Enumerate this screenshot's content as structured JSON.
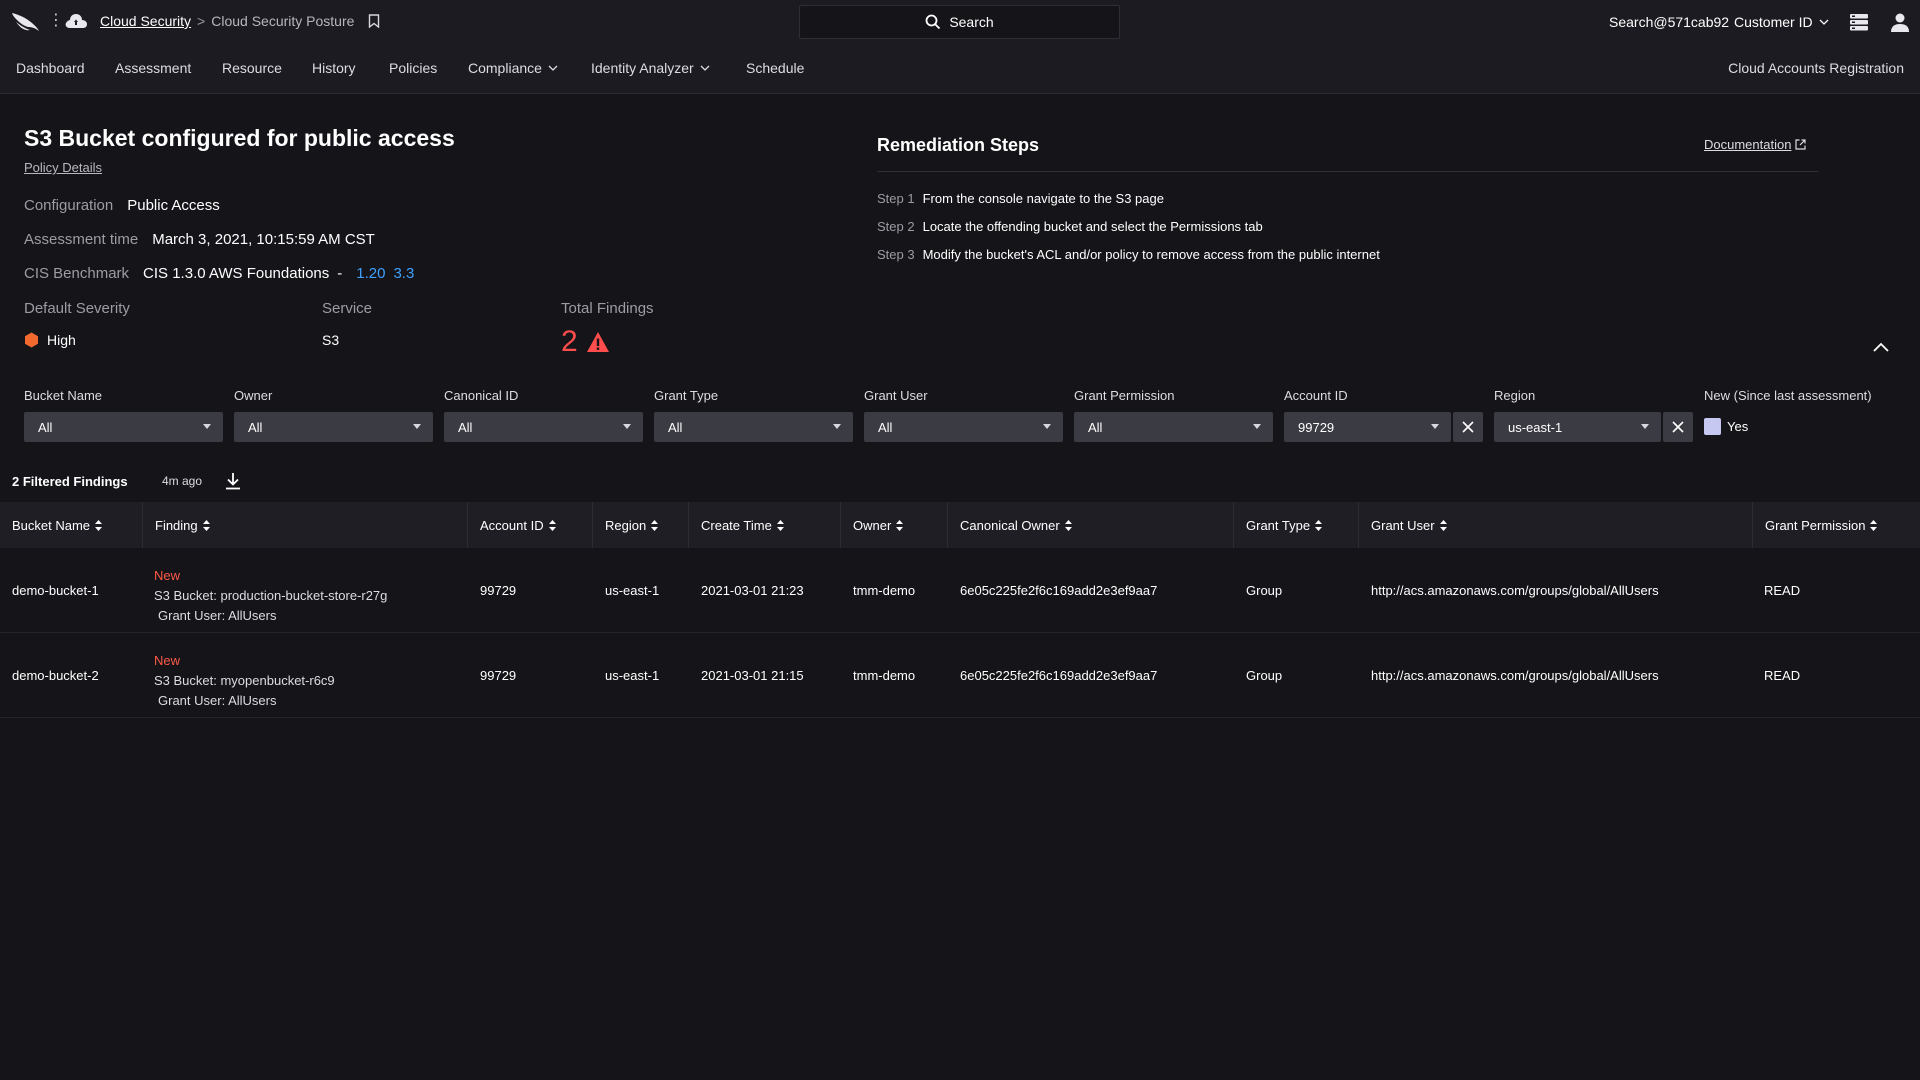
{
  "topbar": {
    "breadcrumb_root": "Cloud Security",
    "breadcrumb_sep": ">",
    "breadcrumb_current": "Cloud Security Posture",
    "search_label": "Search",
    "user": "Search@571cab92",
    "customer_label": "Customer ID"
  },
  "nav": {
    "items": [
      "Dashboard",
      "Assessment",
      "Resource",
      "History",
      "Policies",
      "Compliance",
      "Identity Analyzer",
      "Schedule"
    ],
    "right": "Cloud Accounts Registration"
  },
  "summary": {
    "title": "S3 Bucket configured for public access",
    "policy_link": "Policy Details",
    "configuration_label": "Configuration",
    "configuration_value": "Public Access",
    "assessment_label": "Assessment time",
    "assessment_value": "March 3, 2021, 10:15:59 AM CST",
    "cis_label": "CIS Benchmark",
    "cis_value": "CIS 1.3.0 AWS Foundations",
    "cis_dash": "-",
    "cis_refs": [
      "1.20",
      "3.3"
    ],
    "severity_label": "Default Severity",
    "severity_value": "High",
    "severity_color": "#f26a2e",
    "service_label": "Service",
    "service_value": "S3",
    "total_label": "Total Findings",
    "total_value": "2",
    "total_color": "#ff4d4d"
  },
  "remediation": {
    "title": "Remediation Steps",
    "doc_link": "Documentation",
    "steps": [
      {
        "num": "Step 1",
        "text": "From the console navigate to the S3 page"
      },
      {
        "num": "Step 2",
        "text": "Locate the offending bucket and select the Permissions tab"
      },
      {
        "num": "Step 3",
        "text": "Modify the bucket's ACL and/or policy to remove access from the public internet"
      }
    ]
  },
  "filters": [
    {
      "label": "Bucket Name",
      "value": "All"
    },
    {
      "label": "Owner",
      "value": "All"
    },
    {
      "label": "Canonical ID",
      "value": "All"
    },
    {
      "label": "Grant Type",
      "value": "All"
    },
    {
      "label": "Grant User",
      "value": "All"
    },
    {
      "label": "Grant Permission",
      "value": "All"
    },
    {
      "label": "Account ID",
      "value": "99729"
    },
    {
      "label": "Region",
      "value": "us-east-1"
    }
  ],
  "new_filter": {
    "label": "New (Since last assessment)",
    "option": "Yes"
  },
  "findings": {
    "count_label": "2 Filtered Findings",
    "ago": "4m ago",
    "columns": [
      "Bucket Name",
      "Finding",
      "Account ID",
      "Region",
      "Create Time",
      "Owner",
      "Canonical Owner",
      "Grant Type",
      "Grant User",
      "Grant Permission"
    ],
    "rows": [
      {
        "bucket": "demo-bucket-1",
        "new": "New",
        "finding": "S3 Bucket: production-bucket-store-r27g",
        "finding_sub": "Grant User: AllUsers",
        "account": "99729",
        "region": "us-east-1",
        "create_time": "2021-03-01 21:23",
        "owner": "tmm-demo",
        "canonical_owner": "6e05c225fe2f6c169add2e3ef9aa7",
        "grant_type": "Group",
        "grant_user": "http://acs.amazonaws.com/groups/global/AllUsers",
        "grant_permission": "READ"
      },
      {
        "bucket": "demo-bucket-2",
        "new": "New",
        "finding": "S3 Bucket: myopenbucket-r6c9",
        "finding_sub": "Grant User: AllUsers",
        "account": "99729",
        "region": "us-east-1",
        "create_time": "2021-03-01 21:15",
        "owner": "tmm-demo",
        "canonical_owner": "6e05c225fe2f6c169add2e3ef9aa7",
        "grant_type": "Group",
        "grant_user": "http://acs.amazonaws.com/groups/global/AllUsers",
        "grant_permission": "READ"
      }
    ]
  },
  "icons": {
    "logo": "falcon-logo-icon",
    "cloud": "cloud-icon",
    "bookmark": "bookmark-icon",
    "search": "search-icon",
    "menu": "server-stack-icon",
    "user": "user-icon",
    "warning": "warning-triangle-icon",
    "severity": "hexagon-icon",
    "download": "download-icon",
    "sort": "sort-icon",
    "external": "external-link-icon",
    "collapse": "chevron-up-icon",
    "clear": "close-icon"
  }
}
